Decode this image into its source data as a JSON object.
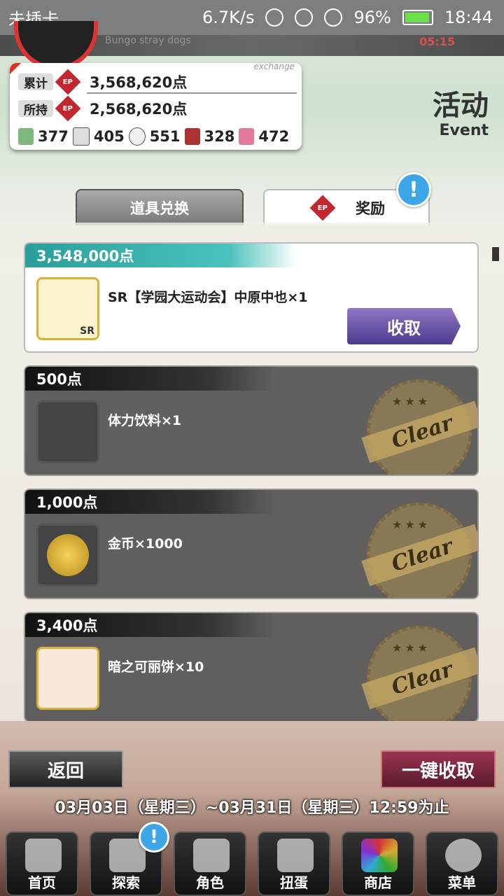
{
  "status_bar": {
    "carrier": "未插卡",
    "speed": "6.7K/s",
    "battery": "96%",
    "time": "18:44"
  },
  "header": {
    "subtitle": "Bungo stray dogs",
    "timer": "05:15",
    "event_title": "活动",
    "event_subtitle": "Event"
  },
  "points": {
    "tag": "exchange",
    "total_label": "累计",
    "total_value": "3,568,620点",
    "owned_label": "所持",
    "owned_value": "2,568,620点",
    "ep_icon": "EP",
    "items": [
      {
        "icon": "book-icon",
        "value": "377",
        "color": "#7fb77e"
      },
      {
        "icon": "dice-icon",
        "value": "405",
        "color": "#dddddd"
      },
      {
        "icon": "fan-icon",
        "value": "551",
        "color": "#f0f0f0"
      },
      {
        "icon": "bento-icon",
        "value": "328",
        "color": "#a33"
      },
      {
        "icon": "drink-icon",
        "value": "472",
        "color": "#e27a9a"
      }
    ]
  },
  "tabs": {
    "exchange": "道具兑换",
    "reward": "奖励",
    "alert": "!"
  },
  "rewards": [
    {
      "points": "3,548,000点",
      "name": "SR【学园大运动会】中原中也×1",
      "status": "claimable",
      "claim_label": "收取",
      "rarity": "SR"
    },
    {
      "points": "500点",
      "name": "体力饮料×1",
      "status": "cleared",
      "stamp": "Clear"
    },
    {
      "points": "1,000点",
      "name": "金币×1000",
      "status": "cleared",
      "stamp": "Clear"
    },
    {
      "points": "3,400点",
      "name": "暗之可丽饼×10",
      "status": "cleared",
      "stamp": "Clear"
    }
  ],
  "buttons": {
    "back": "返回",
    "claim_all": "一键收取"
  },
  "period": "03月03日（星期三）~03月31日（星期三）12:59为止",
  "nav": [
    {
      "label": "首页",
      "icon": "home-icon"
    },
    {
      "label": "探索",
      "icon": "explore-icon"
    },
    {
      "label": "角色",
      "icon": "character-icon"
    },
    {
      "label": "扭蛋",
      "icon": "gacha-icon"
    },
    {
      "label": "商店",
      "icon": "shop-icon"
    },
    {
      "label": "菜单",
      "icon": "menu-icon"
    }
  ],
  "nav_alert": "!"
}
